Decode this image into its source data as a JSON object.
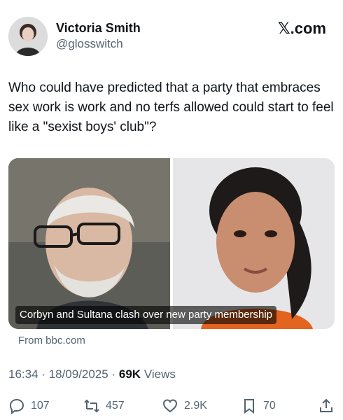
{
  "author": {
    "name": "Victoria Smith",
    "handle": "@glosswitch",
    "avatar_icon": "profile-photo"
  },
  "brand": "𝕏.com",
  "tweet": {
    "text": "Who could have predicted that a party that embraces sex work is work and no terfs allowed could start to feel like a \"sexist boys' club\"?"
  },
  "card": {
    "caption": "Corbyn and Sultana clash over new party membership",
    "source": "From bbc.com"
  },
  "meta": {
    "time": "16:34",
    "date": "18/09/2025",
    "views_count": "69K",
    "views_label": "Views"
  },
  "actions": {
    "replies": "107",
    "reposts": "457",
    "likes": "2.9K",
    "bookmarks": "70"
  },
  "colors": {
    "text": "#0f1419",
    "secondary": "#536471",
    "background": "#ffffff"
  }
}
